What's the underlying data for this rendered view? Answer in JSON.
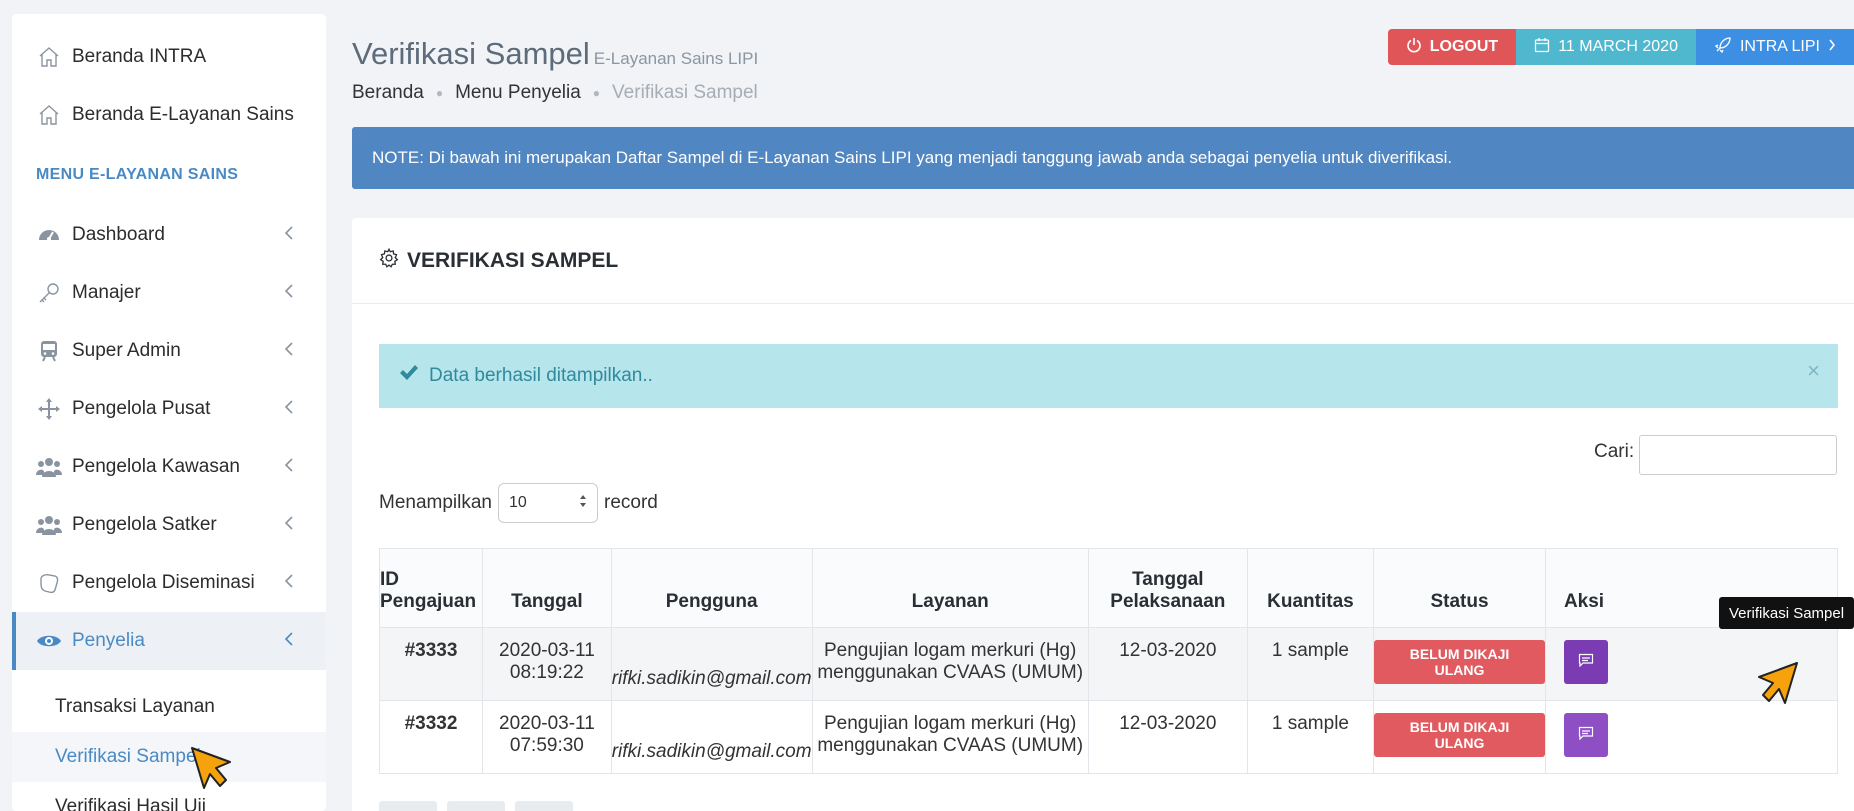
{
  "sidebar": {
    "top_items": [
      {
        "label": "Beranda INTRA",
        "icon": "home-icon"
      },
      {
        "label": "Beranda E-Layanan Sains",
        "icon": "home-icon"
      }
    ],
    "section_title": "MENU E-LAYANAN SAINS",
    "menu": [
      {
        "label": "Dashboard",
        "icon": "dashboard-icon"
      },
      {
        "label": "Manajer",
        "icon": "key-icon"
      },
      {
        "label": "Super Admin",
        "icon": "train-icon"
      },
      {
        "label": "Pengelola Pusat",
        "icon": "move-icon"
      },
      {
        "label": "Pengelola Kawasan",
        "icon": "users-icon"
      },
      {
        "label": "Pengelola Satker",
        "icon": "users-icon"
      },
      {
        "label": "Pengelola Diseminasi",
        "icon": "hand-icon"
      },
      {
        "label": "Penyelia",
        "icon": "eye-icon"
      }
    ],
    "submenu": [
      {
        "label": "Transaksi Layanan"
      },
      {
        "label": "Verifikasi Sampel"
      },
      {
        "label": "Verifikasi Hasil Uji"
      }
    ]
  },
  "header": {
    "title": "Verifikasi Sampel",
    "subtitle": "E-Layanan Sains LIPI",
    "breadcrumb": [
      "Beranda",
      "Menu Penyelia",
      "Verifikasi Sampel"
    ],
    "logout_label": "LOGOUT",
    "date_label": "11 MARCH 2020",
    "intra_label": "INTRA LIPI"
  },
  "note": "NOTE: Di bawah ini merupakan Daftar Sampel di E-Layanan Sains LIPI yang menjadi tanggung jawab anda sebagai penyelia untuk diverifikasi.",
  "card": {
    "title": "VERIFIKASI SAMPEL",
    "alert": "Data berhasil ditampilkan..",
    "alert_close": "×",
    "search_label": "Cari:",
    "length_prefix": "Menampilkan",
    "length_value": "10",
    "length_suffix": "record"
  },
  "table": {
    "headers": [
      "ID Pengajuan",
      "Tanggal",
      "Pengguna",
      "Layanan",
      "Tanggal Pelaksanaan",
      "Kuantitas",
      "Status",
      "Aksi"
    ],
    "rows": [
      {
        "id": "#3333",
        "date": "2020-03-11",
        "time": "08:19:22",
        "user": "rifki.sadikin@gmail.com",
        "service_line1": "Pengujian logam merkuri (Hg)",
        "service_line2": "menggunakan CVAAS (UMUM)",
        "exec_date": "12-03-2020",
        "qty": "1 sample",
        "status": "BELUM DIKAJI ULANG"
      },
      {
        "id": "#3332",
        "date": "2020-03-11",
        "time": "07:59:30",
        "user": "rifki.sadikin@gmail.com",
        "service_line1": "Pengujian logam merkuri (Hg)",
        "service_line2": "menggunakan CVAAS (UMUM)",
        "exec_date": "12-03-2020",
        "qty": "1 sample",
        "status": "BELUM DIKAJI ULANG"
      }
    ]
  },
  "tooltip": "Verifikasi Sampel",
  "colors": {
    "accent": "#4a8ac4",
    "danger": "#e05558",
    "info": "#4fb8cf",
    "primary": "#3d8fe3",
    "purple": "#8e4fc4"
  }
}
